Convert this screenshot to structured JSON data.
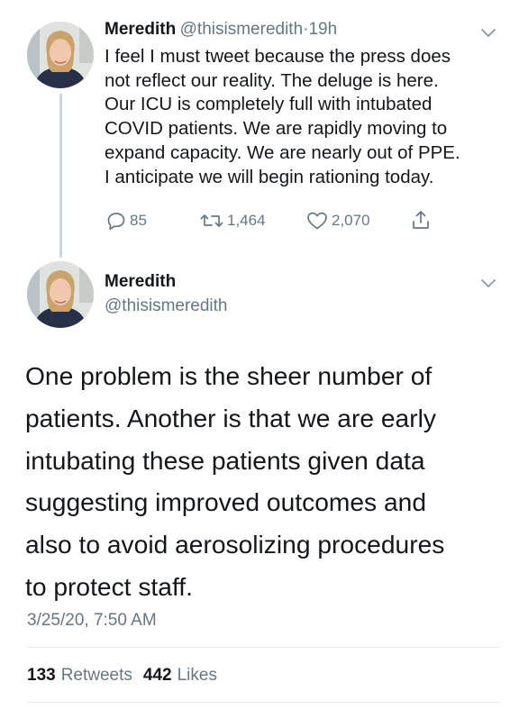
{
  "tweet1": {
    "author_name": "Meredith",
    "author_handle": "@thisismeredith",
    "separator": "·",
    "time": "19h",
    "lines": [
      "I feel I must tweet because the press does",
      "not reflect our reality. The deluge is here.",
      "Our ICU is completely full with intubated",
      "COVID patients. We are rapidly moving to",
      "expand capacity. We are nearly out of PPE.",
      "I anticipate we will begin rationing today."
    ],
    "replies": "85",
    "retweets": "1,464",
    "likes": "2,070"
  },
  "tweet2": {
    "author_name": "Meredith",
    "author_handle": "@thisismeredith",
    "lines": [
      "One problem is the sheer number of",
      "patients. Another is that we are early",
      "intubating these patients given data",
      "suggesting improved outcomes and",
      "also to avoid aerosolizing procedures",
      "to protect staff."
    ],
    "timestamp": "3/25/20, 7:50 AM",
    "retweet_count": "133",
    "retweet_label": "Retweets",
    "like_count": "442",
    "like_label": "Likes"
  },
  "icons": {
    "reply": "reply-icon",
    "retweet": "retweet-icon",
    "like": "heart-icon",
    "share": "share-icon",
    "menu": "chevron-down-icon"
  },
  "colors": {
    "text": "#14171a",
    "secondary": "#657786",
    "divider": "#e6ecf0",
    "thread": "#ccd6dd"
  }
}
